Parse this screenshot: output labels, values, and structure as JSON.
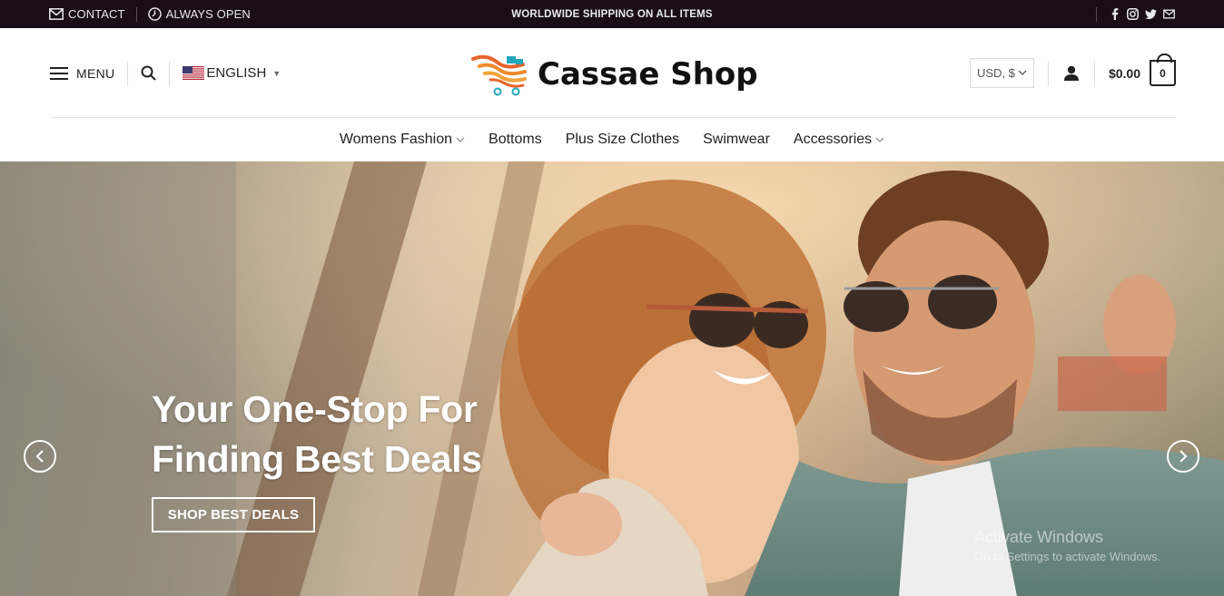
{
  "topbar": {
    "contact_label": "CONTACT",
    "hours_label": "ALWAYS OPEN",
    "promo_text": "WORLDWIDE SHIPPING ON ALL ITEMS",
    "social_icons": [
      "facebook-icon",
      "instagram-icon",
      "twitter-icon",
      "email-icon"
    ],
    "bg_color": "#1a0d16"
  },
  "header": {
    "menu_label": "MENU",
    "language_label": "ENGLISH",
    "brand_name": "Cassae Shop",
    "currency_label": "USD, $",
    "cart_total": "$0.00",
    "cart_count": "0"
  },
  "nav": {
    "items": [
      {
        "label": "Womens Fashion",
        "has_dropdown": true
      },
      {
        "label": "Bottoms",
        "has_dropdown": false
      },
      {
        "label": "Plus Size Clothes",
        "has_dropdown": false
      },
      {
        "label": "Swimwear",
        "has_dropdown": false
      },
      {
        "label": "Accessories",
        "has_dropdown": true
      }
    ]
  },
  "hero": {
    "title_line1": "Your One-Stop For",
    "title_line2": "Finding Best Deals",
    "button_label": "SHOP BEST DEALS"
  },
  "watermark": {
    "line1": "Activate Windows",
    "line2": "Go to Settings to activate Windows."
  }
}
